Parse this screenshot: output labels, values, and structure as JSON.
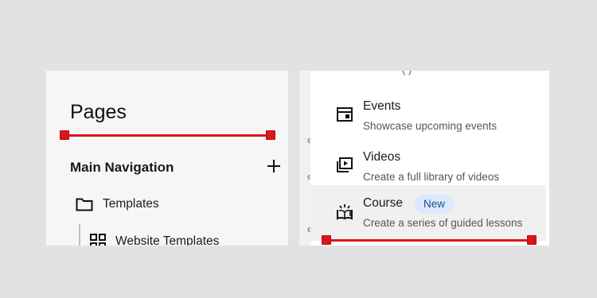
{
  "left": {
    "title": "Pages",
    "section": "Main Navigation",
    "items": [
      {
        "label": "Templates",
        "icon": "folder-icon"
      },
      {
        "label": "Website Templates",
        "icon": "grid-icon"
      }
    ]
  },
  "right": {
    "cut_text": "( )",
    "gap_glyphs": [
      "e",
      "e",
      "e"
    ],
    "items": [
      {
        "name": "Events",
        "desc": "Showcase upcoming events",
        "icon": "calendar-icon"
      },
      {
        "name": "Videos",
        "desc": "Create a full library of videos",
        "icon": "video-library-icon"
      },
      {
        "name": "Course",
        "badge": "New",
        "desc": "Create a series of guided lessons",
        "icon": "open-book-icon"
      }
    ]
  },
  "colors": {
    "measure_red": "#d9161c",
    "badge_bg": "#dbeafc",
    "badge_text": "#1d4f91",
    "highlight": "#f0f0f0"
  }
}
